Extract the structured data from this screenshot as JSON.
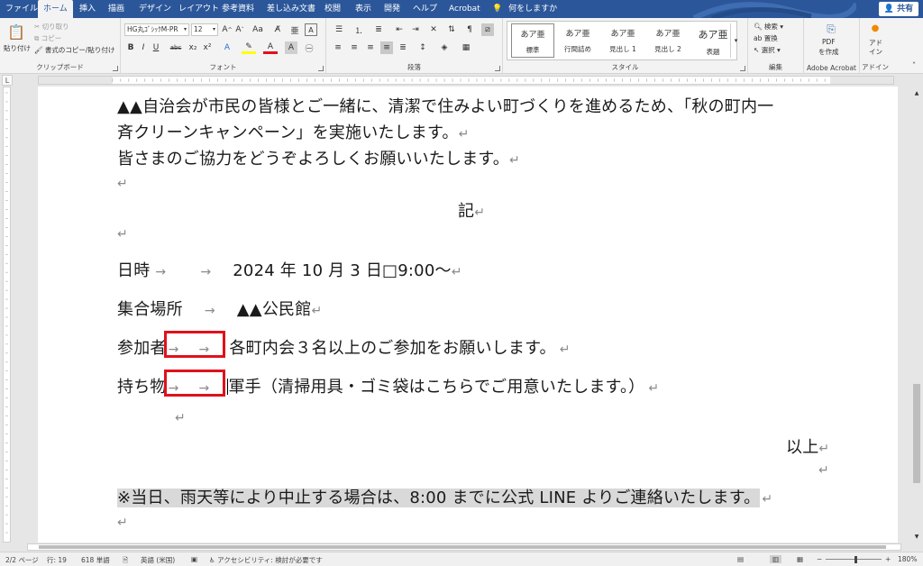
{
  "tabs": [
    "ファイル",
    "ホーム",
    "挿入",
    "描画",
    "デザイン",
    "レイアウト",
    "参考資料",
    "差し込み文書",
    "校閲",
    "表示",
    "開発",
    "ヘルプ",
    "Acrobat"
  ],
  "active_tab": "ホーム",
  "tell_me": "何をしますか",
  "share_label": "共有",
  "clipboard": {
    "paste": "貼り付け",
    "cut": "切り取り",
    "copy": "コピー",
    "format_painter": "書式のコピー/貼り付け",
    "label": "クリップボード"
  },
  "font": {
    "name": "HG丸ｺﾞｼｯｸM-PR",
    "size": "12",
    "label": "フォント"
  },
  "paragraph_label": "段落",
  "styles": {
    "label": "スタイル",
    "items": [
      {
        "sample": "あア亜",
        "name": "標準"
      },
      {
        "sample": "あア亜",
        "name": "行間詰め"
      },
      {
        "sample": "あア亜",
        "name": "見出し 1"
      },
      {
        "sample": "あア亜",
        "name": "見出し 2"
      },
      {
        "sample": "あア亜",
        "name": "表題"
      }
    ]
  },
  "editing": {
    "find": "検索",
    "replace": "置換",
    "select": "選択",
    "label": "編集"
  },
  "acrobat": {
    "pdf_line1": "PDF",
    "pdf_line2": "を作成",
    "label": "Adobe Acrobat"
  },
  "addins": {
    "line1": "アド",
    "line2": "イン",
    "label": "アドイン"
  },
  "document": {
    "line1": "▲▲自治会が市民の皆様とご一緒に、清潔で住みよい町づくりを進めるため、「秋の町内一",
    "line2": "斉クリーンキャンペーン」を実施いたします。",
    "line3": "皆さまのご協力をどうぞよろしくお願いいたします。",
    "ki": "記",
    "date_label": "日時",
    "date_value": "2024 年 10 月 3 日□9:00～",
    "place_label": "集合場所",
    "place_value": "▲▲公民館",
    "participants_label": "参加者",
    "participants_value": "各町内会３名以上のご参加をお願いします。",
    "items_label": "持ち物",
    "items_value": "軍手（清掃用具・ゴミ袋はこちらでご用意いたします。）",
    "ijou": "以上",
    "note": "※当日、雨天等により中止する場合は、8:00 までに公式 LINE よりご連絡いたします。",
    "para_mark": "↵",
    "tab_arrow": "→"
  },
  "status": {
    "page": "2/2 ページ",
    "line": "行: 19",
    "words": "618 単語",
    "language": "英語 (米国)",
    "accessibility": "アクセシビリティ: 検討が必要です",
    "zoom": "180%"
  }
}
